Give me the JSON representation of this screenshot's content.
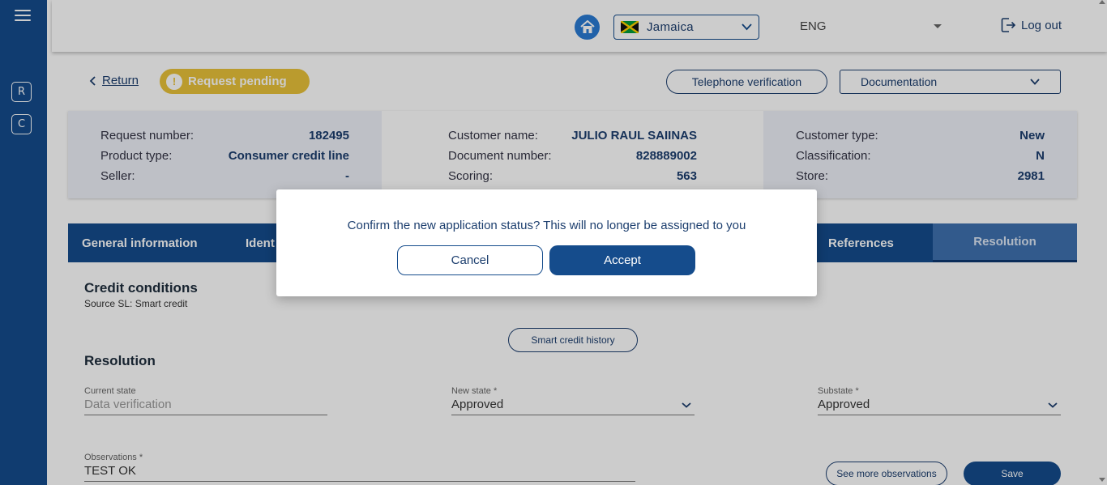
{
  "sidebar": {
    "menu_icon": "hamburger-menu-icon",
    "buttons": [
      "R",
      "C"
    ]
  },
  "header": {
    "home_icon": "home-icon",
    "country": "Jamaica",
    "language": "ENG",
    "logout_label": "Log out"
  },
  "toolbar": {
    "return_label": "Return",
    "status_badge": "Request pending",
    "telephone_label": "Telephone verification",
    "documentation_label": "Documentation"
  },
  "info": {
    "request_number_label": "Request number:",
    "request_number": "182495",
    "product_type_label": "Product type:",
    "product_type": "Consumer credit line",
    "seller_label": "Seller:",
    "seller": "-",
    "customer_name_label": "Customer name:",
    "customer_name": "JULIO RAUL SAIINAS",
    "document_number_label": "Document number:",
    "document_number": "828889002",
    "scoring_label": "Scoring:",
    "scoring": "563",
    "customer_type_label": "Customer type:",
    "customer_type": "New",
    "classification_label": "Classification:",
    "classification": "N",
    "store_label": "Store:",
    "store": "2981"
  },
  "tabs": [
    {
      "label": "General information"
    },
    {
      "label": "Ident"
    },
    {
      "label": "References"
    },
    {
      "label": "Resolution"
    }
  ],
  "credit": {
    "title": "Credit conditions",
    "source": "Source SL: Smart credit",
    "history_button": "Smart credit history"
  },
  "resolution": {
    "title": "Resolution",
    "current_state_label": "Current state",
    "current_state": "Data verification",
    "new_state_label": "New state *",
    "new_state": "Approved",
    "substate_label": "Substate *",
    "substate": "Approved",
    "observations_label": "Observations *",
    "observations": "TEST OK",
    "see_more_button": "See more observations",
    "save_button": "Save"
  },
  "modal": {
    "message": "Confirm the new application status? This will no longer be assigned to you",
    "cancel_label": "Cancel",
    "accept_label": "Accept"
  },
  "colors": {
    "primary": "#154c8c",
    "badge": "#e9c23a"
  }
}
